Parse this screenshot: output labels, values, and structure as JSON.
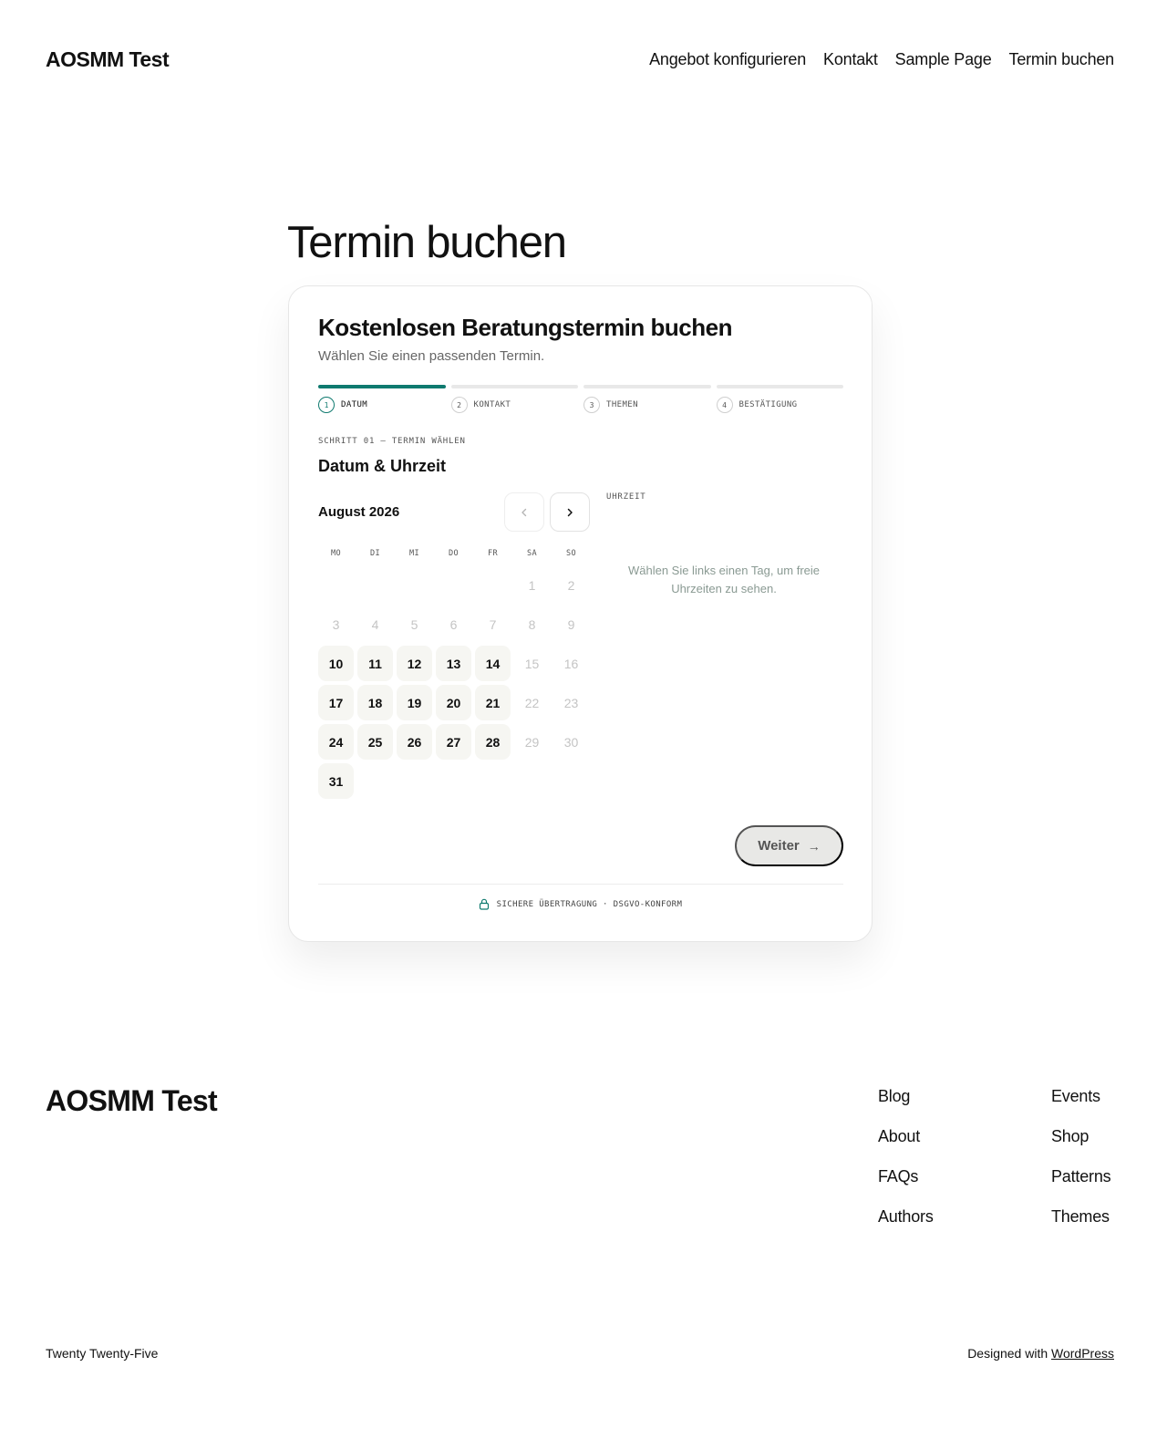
{
  "header": {
    "site_title": "AOSMM Test",
    "nav": [
      {
        "label": "Angebot konfigurieren"
      },
      {
        "label": "Kontakt"
      },
      {
        "label": "Sample Page"
      },
      {
        "label": "Termin buchen"
      }
    ]
  },
  "page": {
    "title": "Termin buchen"
  },
  "booking": {
    "title": "Kostenlosen Beratungstermin buchen",
    "subtitle": "Wählen Sie einen passenden Termin.",
    "steps": [
      {
        "num": "1",
        "label": "DATUM",
        "active": true
      },
      {
        "num": "2",
        "label": "KONTAKT",
        "active": false
      },
      {
        "num": "3",
        "label": "THEMEN",
        "active": false
      },
      {
        "num": "4",
        "label": "BESTÄTIGUNG",
        "active": false
      }
    ],
    "step_kicker": "SCHRITT 01 — TERMIN WÄHLEN",
    "section_title": "Datum & Uhrzeit",
    "calendar": {
      "month_label": "August 2026",
      "weekdays": [
        "MO",
        "DI",
        "MI",
        "DO",
        "FR",
        "SA",
        "SO"
      ],
      "leading_blanks": 5,
      "days": [
        {
          "d": "1",
          "available": false
        },
        {
          "d": "2",
          "available": false
        },
        {
          "d": "3",
          "available": false
        },
        {
          "d": "4",
          "available": false
        },
        {
          "d": "5",
          "available": false
        },
        {
          "d": "6",
          "available": false
        },
        {
          "d": "7",
          "available": false
        },
        {
          "d": "8",
          "available": false
        },
        {
          "d": "9",
          "available": false
        },
        {
          "d": "10",
          "available": true
        },
        {
          "d": "11",
          "available": true
        },
        {
          "d": "12",
          "available": true
        },
        {
          "d": "13",
          "available": true
        },
        {
          "d": "14",
          "available": true
        },
        {
          "d": "15",
          "available": false
        },
        {
          "d": "16",
          "available": false
        },
        {
          "d": "17",
          "available": true
        },
        {
          "d": "18",
          "available": true
        },
        {
          "d": "19",
          "available": true
        },
        {
          "d": "20",
          "available": true
        },
        {
          "d": "21",
          "available": true
        },
        {
          "d": "22",
          "available": false
        },
        {
          "d": "23",
          "available": false
        },
        {
          "d": "24",
          "available": true
        },
        {
          "d": "25",
          "available": true
        },
        {
          "d": "26",
          "available": true
        },
        {
          "d": "27",
          "available": true
        },
        {
          "d": "28",
          "available": true
        },
        {
          "d": "29",
          "available": false
        },
        {
          "d": "30",
          "available": false
        },
        {
          "d": "31",
          "available": true
        }
      ]
    },
    "time": {
      "label": "UHRZEIT",
      "hint": "Wählen Sie links einen Tag, um freie Uhrzeiten zu sehen."
    },
    "next_label": "Weiter",
    "next_arrow": "→",
    "secure_note": "SICHERE ÜBERTRAGUNG · DSGVO-KONFORM",
    "colors": {
      "accent": "#0f7a6f",
      "day_available_bg": "#f6f6f2",
      "day_unavailable": "#c4c4c4"
    }
  },
  "footer": {
    "site_title": "AOSMM Test",
    "col1": [
      {
        "label": "Blog"
      },
      {
        "label": "About"
      },
      {
        "label": "FAQs"
      },
      {
        "label": "Authors"
      }
    ],
    "col2": [
      {
        "label": "Events"
      },
      {
        "label": "Shop"
      },
      {
        "label": "Patterns"
      },
      {
        "label": "Themes"
      }
    ],
    "theme_name": "Twenty Twenty-Five",
    "designed_with": "Designed with",
    "designed_link": "WordPress"
  }
}
